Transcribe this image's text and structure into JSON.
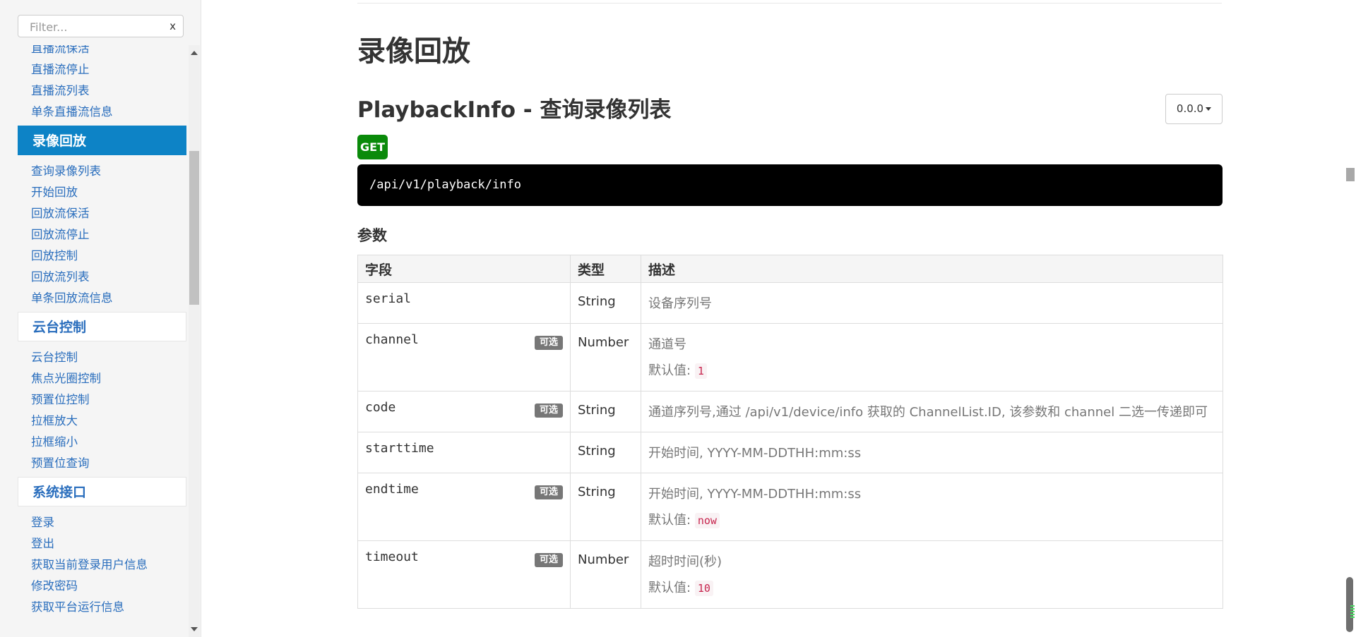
{
  "sidebar": {
    "filter_placeholder": "Filter...",
    "filter_clear": "x",
    "sections": [
      {
        "items": [
          "直播流保活",
          "直播流停止",
          "直播流列表",
          "单条直播流信息"
        ]
      },
      {
        "header": "录像回放",
        "active": true,
        "items": [
          "查询录像列表",
          "开始回放",
          "回放流保活",
          "回放流停止",
          "回放控制",
          "回放流列表",
          "单条回放流信息"
        ]
      },
      {
        "header": "云台控制",
        "active": false,
        "items": [
          "云台控制",
          "焦点光圈控制",
          "预置位控制",
          "拉框放大",
          "拉框缩小",
          "预置位查询"
        ]
      },
      {
        "header": "系统接口",
        "active": false,
        "items": [
          "登录",
          "登出",
          "获取当前登录用户信息",
          "修改密码",
          "获取平台运行信息"
        ]
      }
    ]
  },
  "main": {
    "section_title": "录像回放",
    "endpoint_title": "PlaybackInfo - 查询录像列表",
    "version": "0.0.0",
    "method": "GET",
    "url": "/api/v1/playback/info",
    "params_title": "参数",
    "table": {
      "headers": [
        "字段",
        "类型",
        "描述"
      ],
      "rows": [
        {
          "field": "serial",
          "optional": false,
          "type": "String",
          "desc": "设备序列号"
        },
        {
          "field": "channel",
          "optional": true,
          "type": "Number",
          "desc": "通道号",
          "default_label": "默认值:",
          "default": "1"
        },
        {
          "field": "code",
          "optional": true,
          "type": "String",
          "desc": "通道序列号,通过 /api/v1/device/info 获取的 ChannelList.ID, 该参数和 channel 二选一传递即可"
        },
        {
          "field": "starttime",
          "optional": false,
          "type": "String",
          "desc": "开始时间, YYYY-MM-DDTHH:mm:ss"
        },
        {
          "field": "endtime",
          "optional": true,
          "type": "String",
          "desc": "开始时间, YYYY-MM-DDTHH:mm:ss",
          "default_label": "默认值:",
          "default": "now"
        },
        {
          "field": "timeout",
          "optional": true,
          "type": "Number",
          "desc": "超时时间(秒)",
          "default_label": "默认值:",
          "default": "10"
        }
      ],
      "optional_label": "可选"
    }
  }
}
